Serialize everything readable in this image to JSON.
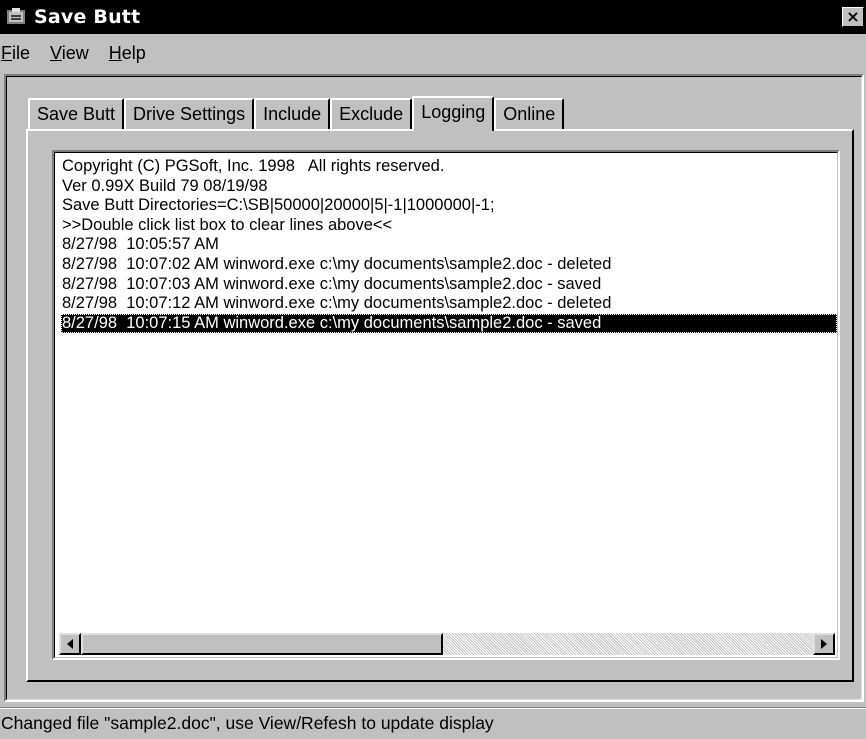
{
  "window": {
    "title": "Save Butt",
    "close_label": "×"
  },
  "menu": {
    "items": [
      {
        "label_accel": "F",
        "label_rest": "ile"
      },
      {
        "label_accel": "V",
        "label_rest": "iew"
      },
      {
        "label_accel": "H",
        "label_rest": "elp"
      }
    ]
  },
  "tabs": [
    {
      "label": "Save Butt",
      "active": false
    },
    {
      "label": "Drive Settings",
      "active": false
    },
    {
      "label": "Include",
      "active": false
    },
    {
      "label": "Exclude",
      "active": false
    },
    {
      "label": "Logging",
      "active": true
    },
    {
      "label": "Online",
      "active": false
    }
  ],
  "log": {
    "lines": [
      "Copyright (C) PGSoft, Inc. 1998   All rights reserved.",
      "Ver 0.99X Build 79 08/19/98",
      "Save Butt Directories=C:\\SB|50000|20000|5|-1|1000000|-1;",
      ">>Double click list box to clear lines above<<",
      "8/27/98  10:05:57 AM",
      "8/27/98  10:07:02 AM winword.exe c:\\my documents\\sample2.doc - deleted",
      "8/27/98  10:07:03 AM winword.exe c:\\my documents\\sample2.doc - saved",
      "8/27/98  10:07:12 AM winword.exe c:\\my documents\\sample2.doc - deleted",
      "8/27/98  10:07:15 AM winword.exe c:\\my documents\\sample2.doc - saved"
    ],
    "selected_index": 8
  },
  "status": {
    "text": "Changed file \"sample2.doc\",  use View/Refesh to update display"
  },
  "icons": {
    "app": "app-icon",
    "close": "close-icon",
    "scroll_left": "scroll-left-arrow-icon",
    "scroll_right": "scroll-right-arrow-icon"
  }
}
